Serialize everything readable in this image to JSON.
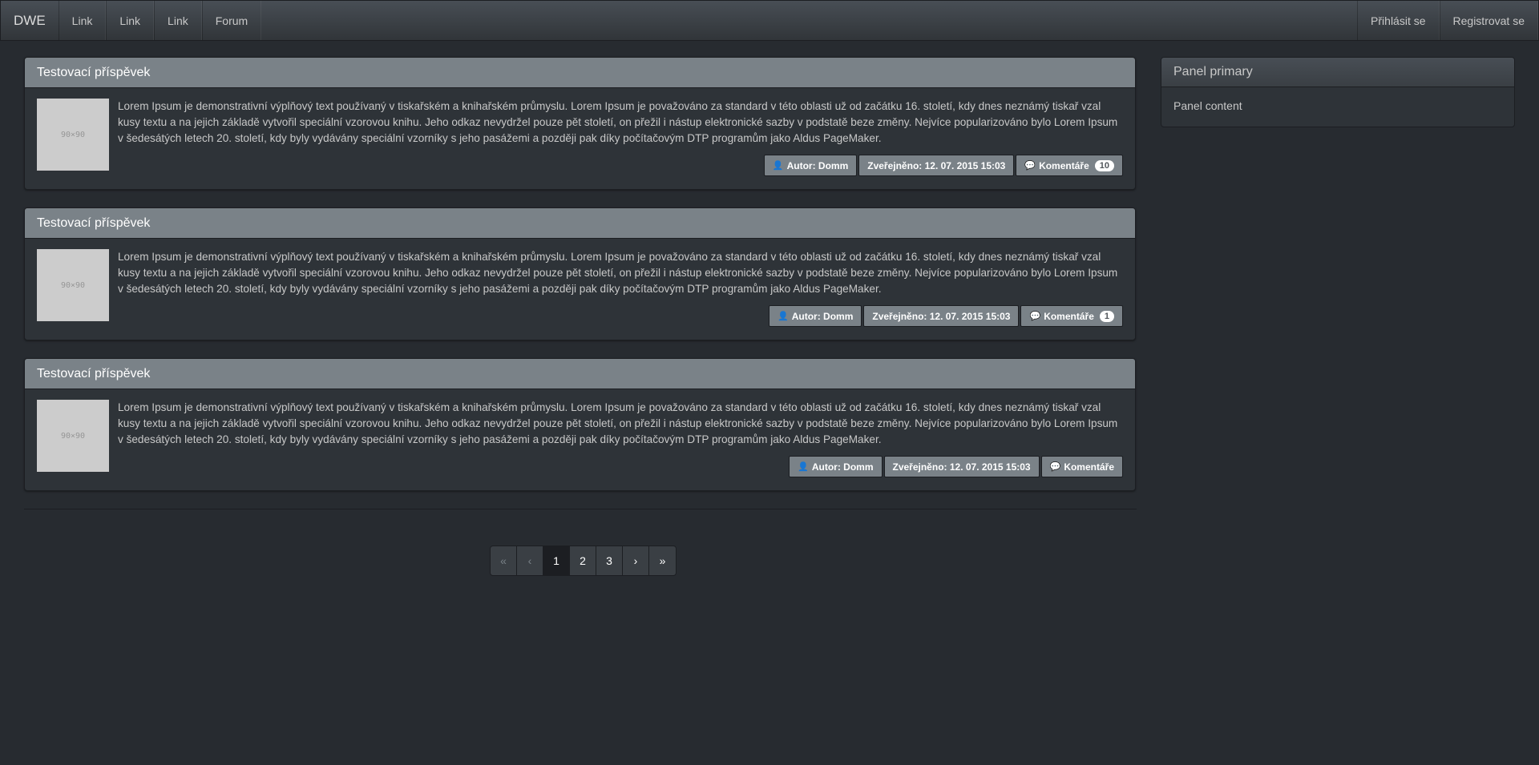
{
  "navbar": {
    "brand": "DWE",
    "links": [
      "Link",
      "Link",
      "Link",
      "Forum"
    ],
    "right": [
      "Přihlásit se",
      "Registrovat se"
    ]
  },
  "posts": [
    {
      "title": "Testovací příspěvek",
      "thumb": "90×90",
      "text": "Lorem Ipsum je demonstrativní výplňový text používaný v tiskařském a knihařském průmyslu. Lorem Ipsum je považováno za standard v této oblasti už od začátku 16. století, kdy dnes neznámý tiskař vzal kusy textu a na jejich základě vytvořil speciální vzorovou knihu. Jeho odkaz nevydržel pouze pět století, on přežil i nástup elektronické sazby v podstatě beze změny. Nejvíce popularizováno bylo Lorem Ipsum v šedesátých letech 20. století, kdy byly vydávány speciální vzorníky s jeho pasážemi a později pak díky počítačovým DTP programům jako Aldus PageMaker.",
      "author": "Autor: Domm",
      "published": "Zveřejněno: 12. 07. 2015 15:03",
      "comments_label": "Komentáře",
      "comments_count": "10"
    },
    {
      "title": "Testovací příspěvek",
      "thumb": "90×90",
      "text": "Lorem Ipsum je demonstrativní výplňový text používaný v tiskařském a knihařském průmyslu. Lorem Ipsum je považováno za standard v této oblasti už od začátku 16. století, kdy dnes neznámý tiskař vzal kusy textu a na jejich základě vytvořil speciální vzorovou knihu. Jeho odkaz nevydržel pouze pět století, on přežil i nástup elektronické sazby v podstatě beze změny. Nejvíce popularizováno bylo Lorem Ipsum v šedesátých letech 20. století, kdy byly vydávány speciální vzorníky s jeho pasážemi a později pak díky počítačovým DTP programům jako Aldus PageMaker.",
      "author": "Autor: Domm",
      "published": "Zveřejněno: 12. 07. 2015 15:03",
      "comments_label": "Komentáře",
      "comments_count": "1"
    },
    {
      "title": "Testovací příspěvek",
      "thumb": "90×90",
      "text": "Lorem Ipsum je demonstrativní výplňový text používaný v tiskařském a knihařském průmyslu. Lorem Ipsum je považováno za standard v této oblasti už od začátku 16. století, kdy dnes neznámý tiskař vzal kusy textu a na jejich základě vytvořil speciální vzorovou knihu. Jeho odkaz nevydržel pouze pět století, on přežil i nástup elektronické sazby v podstatě beze změny. Nejvíce popularizováno bylo Lorem Ipsum v šedesátých letech 20. století, kdy byly vydávány speciální vzorníky s jeho pasážemi a později pak díky počítačovým DTP programům jako Aldus PageMaker.",
      "author": "Autor: Domm",
      "published": "Zveřejněno: 12. 07. 2015 15:03",
      "comments_label": "Komentáře",
      "comments_count": ""
    }
  ],
  "pagination": {
    "first": "«",
    "prev": "‹",
    "pages": [
      "1",
      "2",
      "3"
    ],
    "active": "1",
    "next": "›",
    "last": "»"
  },
  "panel": {
    "title": "Panel primary",
    "content": "Panel content"
  },
  "icons": {
    "user": "user-icon",
    "comments": "comments-icon"
  },
  "colors": {
    "background": "#272b30",
    "post_header": "#7a8288",
    "active_page": "#1c1e22"
  }
}
